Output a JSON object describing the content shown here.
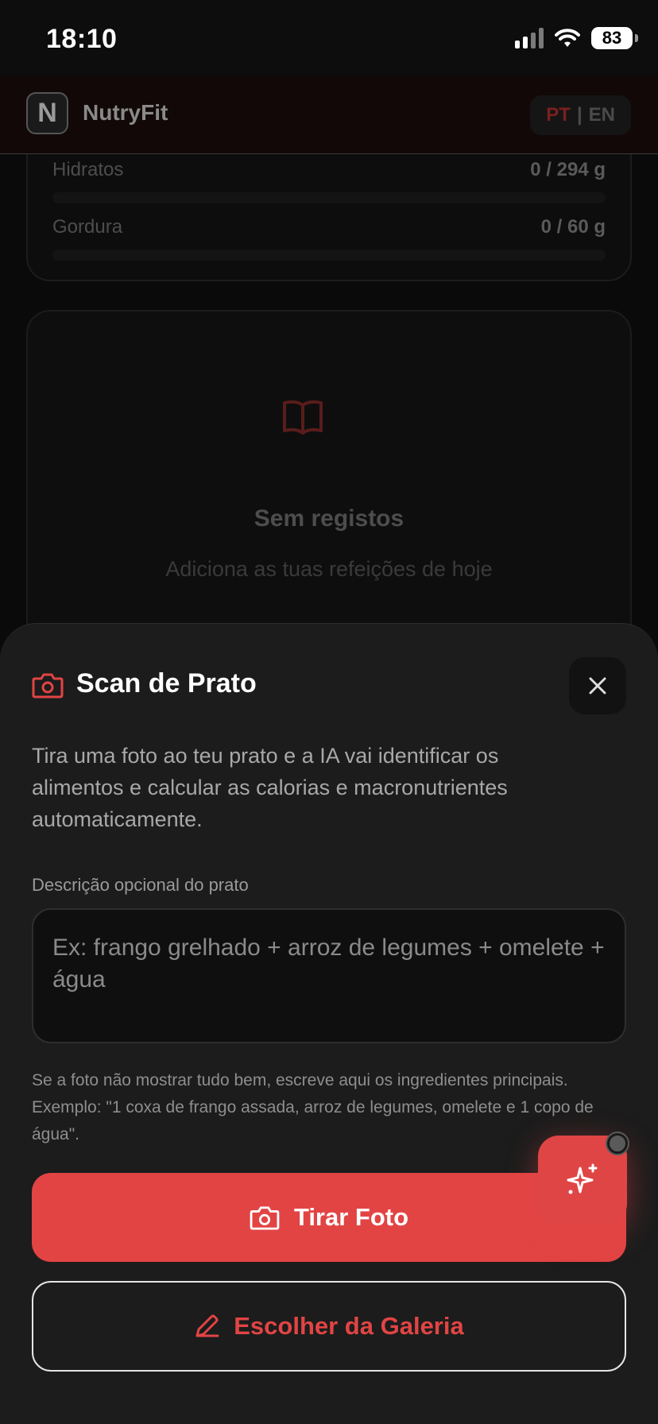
{
  "status_bar": {
    "time": "18:10",
    "battery": "83"
  },
  "app_header": {
    "logo_letter": "N",
    "brand": "NutryFit",
    "lang_pt": "PT",
    "lang_sep": "|",
    "lang_en": "EN"
  },
  "background": {
    "macros": [
      {
        "label": "Hidratos",
        "value": "0 / 294 g"
      },
      {
        "label": "Gordura",
        "value": "0 / 60 g"
      }
    ],
    "empty": {
      "title": "Sem registos",
      "subtitle": "Adiciona as tuas refeições de hoje"
    }
  },
  "sheet": {
    "title": "Scan de Prato",
    "description": "Tira uma foto ao teu prato e a IA vai identificar os alimentos e calcular as calorias e macronutrientes automaticamente.",
    "field_label": "Descrição opcional do prato",
    "field_placeholder": "Ex: frango grelhado + arroz de legumes + omelete + água",
    "field_value": "",
    "hint": "Se a foto não mostrar tudo bem, escreve aqui os ingredientes principais. Exemplo: \"1 coxa de frango assada, arroz de legumes, omelete e 1 copo de água\".",
    "take_photo_label": "Tirar Foto",
    "gallery_label": "Escolher da Galeria"
  },
  "colors": {
    "accent": "#e24444",
    "sheet_bg": "#1c1c1c"
  },
  "icons": [
    "camera-icon",
    "close-icon",
    "pencil-icon",
    "sparkles-icon",
    "book-icon",
    "wifi-icon",
    "signal-icon",
    "battery-icon"
  ]
}
